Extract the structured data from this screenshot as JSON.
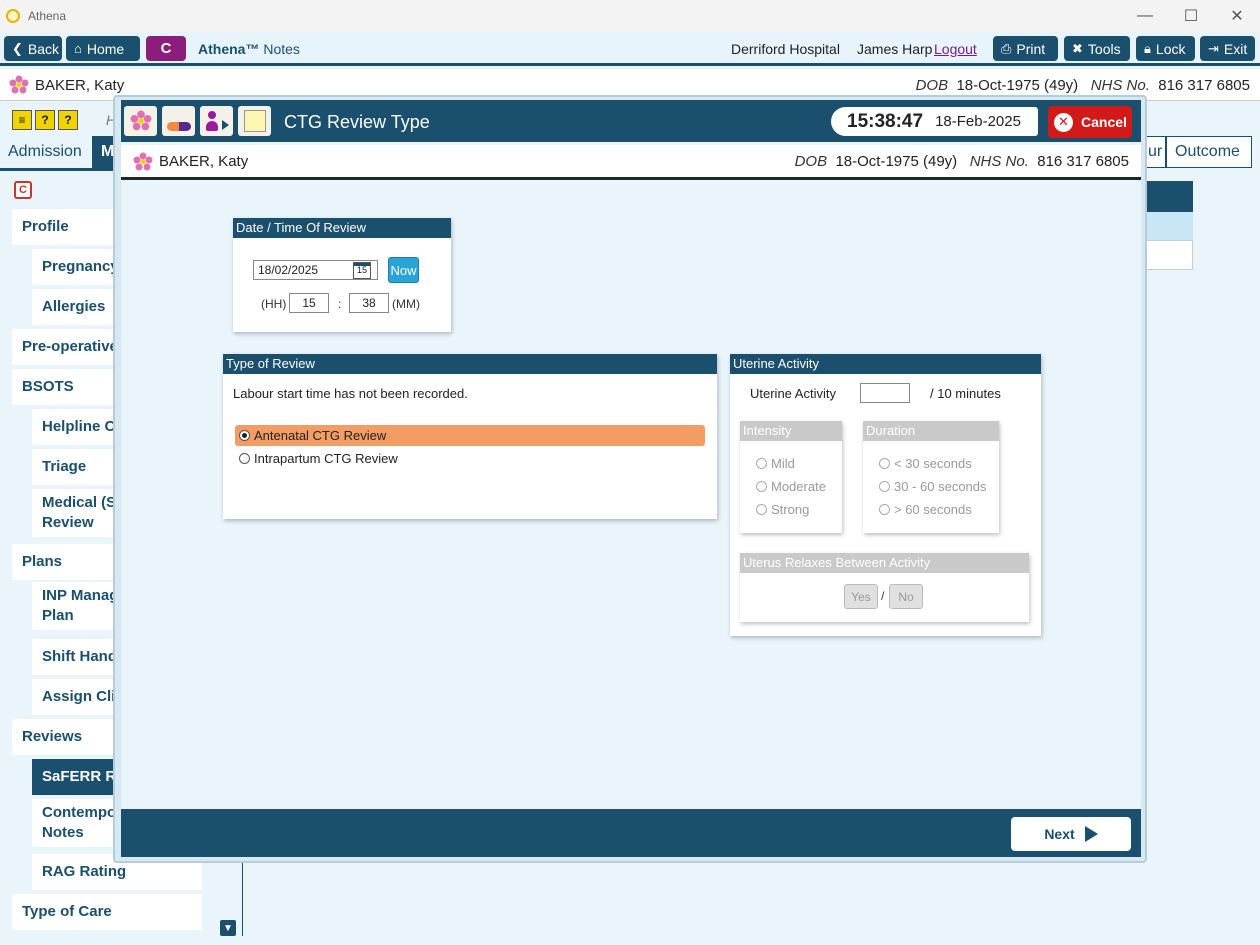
{
  "window": {
    "title": "Athena",
    "min": "—",
    "max": "☐",
    "close": "✕"
  },
  "toolbar": {
    "back": "Back",
    "home": "Home",
    "c_label": "C",
    "brand_bold": "Athena™",
    "brand_rest": " Notes",
    "hospital": "Derriford Hospital",
    "user": "James Harp",
    "logout": "Logout",
    "print": "Print",
    "tools": "Tools",
    "lock": "Lock",
    "exit": "Exit"
  },
  "patient": {
    "name": "BAKER, Katy",
    "dob_label": "DOB",
    "dob": "18-Oct-1975 (49y)",
    "nhs_label": "NHS No.",
    "nhs": "816 317 6805"
  },
  "background": {
    "tabs": [
      "Admission",
      "M",
      "ur",
      "Outcome"
    ],
    "nav": [
      "Profile",
      "Pregnancy",
      "Allergies",
      "Pre-operative",
      "BSOTS",
      "Helpline Co",
      "Triage",
      "Medical (Sa",
      "Review",
      "Plans",
      "INP Manag",
      "Plan",
      "Shift Hando",
      "Assign Clin",
      "Reviews",
      "SaFERR Rev",
      "Contempo",
      "Notes",
      "RAG Rating",
      "Type of Care"
    ],
    "h_stub": "H"
  },
  "modal": {
    "title": "CTG Review Type",
    "time": "15:38:47",
    "date": "18-Feb-2025",
    "cancel": "Cancel",
    "datetime_panel": {
      "header": "Date / Time Of Review",
      "date_value": "18/02/2025",
      "cal_day": "15",
      "now": "Now",
      "hh_label": "(HH)",
      "hh_value": "15",
      "sep": ":",
      "mm_value": "38",
      "mm_label": "(MM)"
    },
    "type_panel": {
      "header": "Type of Review",
      "note": "Labour start time has not been recorded.",
      "options": [
        "Antenatal CTG Review",
        "Intrapartum CTG Review"
      ],
      "selected": "Antenatal CTG Review"
    },
    "uterine_panel": {
      "header": "Uterine Activity",
      "label": "Uterine Activity",
      "value": "",
      "unit": "/ 10 minutes",
      "intensity_header": "Intensity",
      "intensity": [
        "Mild",
        "Moderate",
        "Strong"
      ],
      "duration_header": "Duration",
      "duration": [
        "< 30 seconds",
        "30 - 60 seconds",
        "> 60 seconds"
      ],
      "relax_header": "Uterus Relaxes Between Activity",
      "yes": "Yes",
      "slash": "/",
      "no": "No"
    },
    "next": "Next"
  },
  "colors": {
    "primary": "#1a4f6e",
    "accent_purple": "#8b1e7a",
    "cancel": "#d21a1a",
    "selected": "#f39c63",
    "now": "#2aa4d8"
  }
}
